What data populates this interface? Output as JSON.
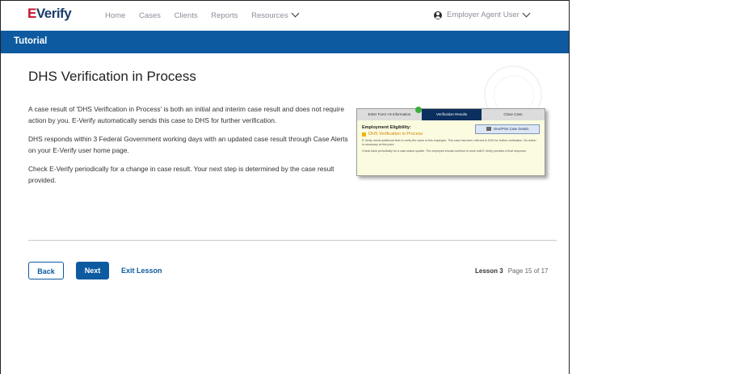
{
  "header": {
    "logo_text": "E‑Verify",
    "nav": [
      "Home",
      "Cases",
      "Clients",
      "Reports",
      "Resources"
    ],
    "user_label": "Employer Agent User"
  },
  "section_title": "Tutorial",
  "page_title": "DHS Verification in Process",
  "paragraphs": [
    "A case result of 'DHS Verification in Process' is both an initial and interim case result and does not require action by you. E-Verify automatically sends this case to DHS for further verification.",
    "DHS responds within 3 Federal Government working days with an updated case result through Case Alerts on your E-Verify user home page.",
    "Check E-Verify periodically for a change in case result. Your next step is determined by the case result provided."
  ],
  "example_screen": {
    "steps": [
      "Enter Form I-9 Information",
      "Verification Results",
      "Close Case"
    ],
    "eligibility_label": "Employment Eligibility:",
    "status": "DHS Verification in Process",
    "print_button": "View/Print Case Details",
    "notes": [
      "E-Verify needs additional time to verify the name of this employee. This case has been referred to DHS for further verification. No action is necessary at this point.",
      "Check back periodically for a case status update. The employee should continue to work until E-Verify provides a final response."
    ]
  },
  "footer": {
    "back": "Back",
    "next": "Next",
    "exit": "Exit Lesson",
    "lesson": "Lesson 3",
    "page": "Page 15 of 17"
  }
}
